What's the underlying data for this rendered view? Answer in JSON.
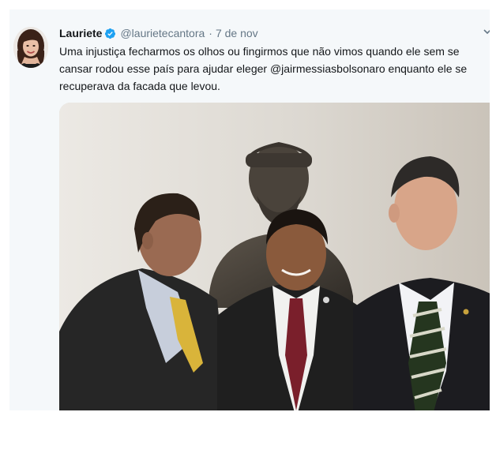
{
  "tweet": {
    "display_name": "Lauriete",
    "verified": true,
    "handle": "@laurietecantora",
    "separator": "·",
    "timestamp": "7 de nov",
    "text": "Uma injustiça fecharmos os olhos ou fingirmos que não vimos quando ele sem se\ncansar rodou esse país para ajudar eleger @jairmessiasbolsonaro enquanto ele se\nrecuperava da facada que levou.",
    "icons": {
      "verified": "verified-badge-icon",
      "menu": "chevron-down-icon"
    },
    "colors": {
      "verified_blue": "#1da1f2",
      "name": "#14171a",
      "meta": "#657786",
      "card_bg": "#f5f8fa"
    }
  }
}
